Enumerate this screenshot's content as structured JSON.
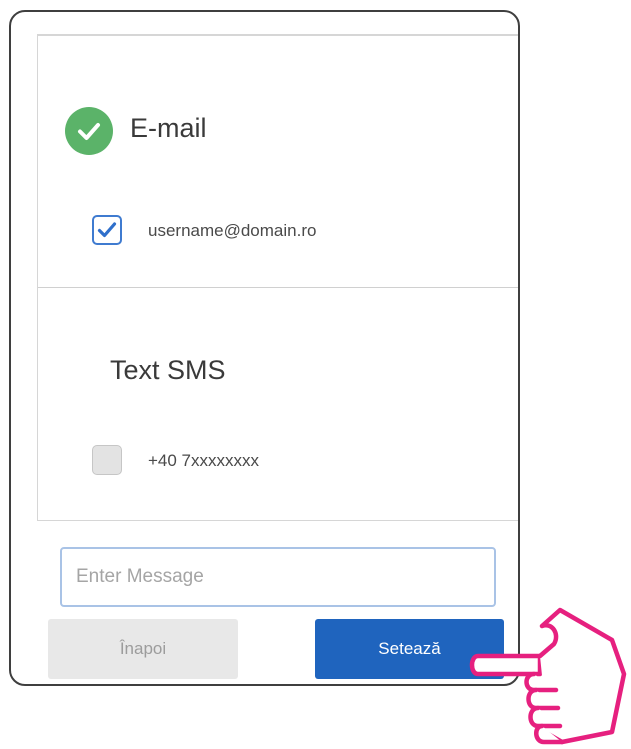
{
  "email_section": {
    "title": "E-mail",
    "contact": "username@domain.ro",
    "checked": true
  },
  "sms_section": {
    "title": "Text SMS",
    "contact": "+40 7xxxxxxxx",
    "checked": false
  },
  "message": {
    "placeholder": "Enter Message",
    "value": ""
  },
  "buttons": {
    "back_label": "Înapoi",
    "set_label": "Setează"
  },
  "colors": {
    "primary": "#1f64be",
    "success": "#5bb369",
    "checkbox_border": "#3f7bd0",
    "disabled_bg": "#e8e8e8",
    "pointer_hand": "#e6207f"
  },
  "icons": {
    "verified": "check-circle-icon",
    "checkmark": "checkmark-icon",
    "pointer": "pointing-hand-icon"
  }
}
